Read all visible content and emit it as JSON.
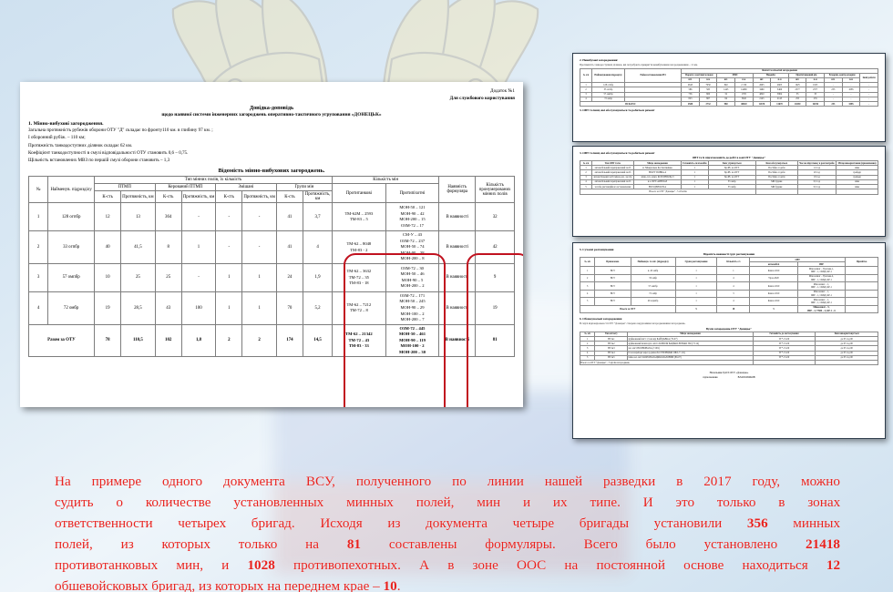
{
  "document": {
    "annex_label": "Додаток №1",
    "restriction": "Для службового користування",
    "title": "Довідка-доповідь",
    "subtitle": "щодо наявної системи інженерних загороджень оперативно-тактичного угруповання «ДОНЕЦЬК»",
    "section_heading": "1. Мінно-вибухові загородження.",
    "lines": [
      "Загальна протяжність рубежів оборони ОТУ \"Д\" складає по фронту110 км. в глибину 97 км. ;",
      "I оборонний рубіж. – 110 км;",
      "Протяжність танкодоступних ділянок складає 62 км.",
      "Коефіцієнт танкодоступності в смузі відповідальності ОТУ становить 0,6 – 0,75.",
      "Щільність встановлених МВЗ по першій смузі оборони становить – 1,3"
    ],
    "table_caption": "Відомість мінно-вибухових загороджень.",
    "table": {
      "group_headers": {
        "num": "№",
        "unit": "Найменув. підрозділу",
        "field_types": "Тип мінних полів, їх кількість",
        "mine_count": "Кількість мін",
        "formular": "Наявність формуляра",
        "numbered": "Кількість пронумерованих мінних полів"
      },
      "type_cols": [
        "ПТМП",
        "Керований ПТМП",
        "Змішані",
        "Групи мін"
      ],
      "sub_cols": [
        "К-сть",
        "Протяжність, км"
      ],
      "mine_cols": [
        "Протитанкові",
        "Протипіхотні"
      ],
      "rows": [
        {
          "num": "1",
          "unit": "128 огпбр",
          "ptmp_n": "12",
          "ptmp_km": "13",
          "ker_n": "364",
          "ker_km": "-",
          "mix_n": "-",
          "mix_km": "-",
          "grp_n": "41",
          "grp_km": "3,7",
          "at": "ТМ-62М – 2593\nТМ-83 – 5",
          "ap": "МОН-50 – 121\nМОН-90 – 42\nМОН-200 – 15\nОЗМ-72 – 17",
          "formular": "В наявності",
          "numbered": "32"
        },
        {
          "num": "2",
          "unit": "33 огпбр",
          "ptmp_n": "40",
          "ptmp_km": "41,5",
          "ker_n": "8",
          "ker_km": "1",
          "mix_n": "-",
          "mix_km": "-",
          "grp_n": "41",
          "grp_km": "4",
          "at": "ТМ-62 – 8048\nТМ-83 - 2",
          "ap": "СМ-У – 43\nОЗМ-72 – 237\nМОН-50 – 74\nМОН-90 – 38\nМОН-200 – 8",
          "formular": "В наявності",
          "numbered": "42"
        },
        {
          "num": "3",
          "unit": "57 омпбр",
          "ptmp_n": "10",
          "ptmp_km": "25",
          "ker_n": "25",
          "ker_km": "-",
          "mix_n": "1",
          "mix_km": "1",
          "grp_n": "24",
          "grp_km": "1,9",
          "at": "ТМ-62 – 3632\nТМ-72 – 35\nТМ-83 - 18",
          "ap": "ОЗМ-72 – 30\nМОН-50 – 46\nМОН-90 – 5\nМОН-200 – 2",
          "formular": "В наявності",
          "numbered": "9"
        },
        {
          "num": "4",
          "unit": "72 омбр",
          "ptmp_n": "19",
          "ptmp_km": "28,5",
          "ker_n": "43",
          "ker_km": "100",
          "mix_n": "1",
          "mix_km": "1",
          "grp_n": "70",
          "grp_km": "5,2",
          "at": "ТМ-62 – 7212\nТМ-72 – 8",
          "ap": "ОЗМ-72 – 171\nМОН-50 – 245\nМОН-90 – 29\nМОН-100 – 2\nМОН-200 – 7",
          "formular": "В наявності",
          "numbered": "19"
        }
      ],
      "total_row": {
        "label": "Разом за ОТУ",
        "ptmp_n": "78",
        "ptmp_km": "110,5",
        "ker_n": "102",
        "ker_km": "1,8",
        "mix_n": "2",
        "mix_km": "2",
        "grp_n": "174",
        "grp_km": "14,5",
        "at": "ТМ-62 – 21342\nТМ-72 – 43\nТМ-83 - 33",
        "ap": "ОЗМ-72 – 445\nМОН-50 – 461\nМОН-90 – 119\nМОН-100 - 2\nМОН-200 – 30",
        "formular": "В наявності",
        "numbered": "81"
      }
    }
  },
  "thumbnails": {
    "t1": {
      "heading": "2. Невибухові загородження:",
      "note": "Протяжність танкодоступних ділянок, які потребують прикриття невибуховими загородженнями – 11 км.",
      "cap": "Якісні та кількісні загородження",
      "cols": [
        "№ з/п",
        "Найменування підрозділу",
        "Район встановлення НЗ",
        "Пороги з кам'яної кладки",
        "МЗП",
        "Надовби",
        "Протитанковий рів",
        "Ескарпи, контр-ескарпи",
        "Інші роботи"
      ],
      "sub": [
        "шт.",
        "п.м"
      ],
      "rows": [
        {
          "n": "1",
          "u": "128 огпбр",
          "v": [
            "2643",
            "7950",
            "840",
            "2 150",
            "2605",
            "2605",
            "1025",
            "1025",
            "-",
            "-",
            "-"
          ]
        },
        {
          "n": "2",
          "u": "33 огпбр",
          "v": [
            "586",
            "585",
            "1445",
            "14480",
            "3460",
            "3460",
            "2577",
            "2577",
            "253",
            "1085",
            "-"
          ]
        },
        {
          "n": "3",
          "u": "57 омпбр",
          "v": [
            "756",
            "800",
            "32",
            "1705",
            "4820",
            "5804",
            "35",
            "35",
            "-",
            "-",
            "-"
          ]
        },
        {
          "n": "4",
          "u": "72 омбр",
          "v": [
            "823",
            "867",
            "84",
            "5645",
            "2145",
            "2145",
            "255",
            "255",
            "-",
            "-",
            "-"
          ]
        }
      ],
      "sum_label": "ВСЬОГО:",
      "sum": [
        "2588",
        "2732",
        "980",
        "48020",
        "12670",
        "12670",
        "10250",
        "10250",
        "253",
        "1085",
        "-"
      ]
    },
    "t2": {
      "heading": "3. ОВТ та інші, які обслуговуються та робиться ремонт",
      "cap": "ОВТ та їх підготовленість до робіт в зоні ОТУ \"Донецьк\"",
      "cols": [
        "№ з/п",
        "Тип ОВТ та ін.",
        "Місце знаходження",
        "Готовність сил/засобів",
        "Ким утримується",
        "Ким обслуговується",
        "Час на підготовку в разі потреби",
        "Місце використання (призначення)"
      ],
      "rows": [
        {
          "v": [
            "1",
            "автомобільний переправочний засіб",
            "м. Мінеральне Костянтинівка",
            "1",
            "Бр.ІН- на ОТУ",
            "Постійно 4 доби",
            "1,5 год",
            "зима"
          ]
        },
        {
          "v": [
            "2",
            "автомобільний переправочний засіб",
            "ВП.РУ ПОВБА-4",
            "1",
            "Бр.ІН- на ОТУ",
            "Постійно 4 доби",
            "20 год",
            "грейдер"
          ]
        },
        {
          "v": [
            "3",
            "автомобільний засіб мінно-раз. засобу",
            "мінн.-тех. комп. КСПЛ/ЮК/Бр.З",
            "1",
            "Бр.ІН- на ОТУ",
            "Постійно 4 доби",
            "18 год",
            "грейдер"
          ]
        },
        {
          "v": [
            "4",
            "автомобільний переправочний засіб",
            "в.ч. ПРУ-АЙН БАЗ",
            "1",
            "33 омбр",
            "МБ будник",
            "0,5 год",
            "зима"
          ]
        },
        {
          "v": [
            "5",
            "засоби дистанційного встановлення",
            "ВП.З/ДВ/Б.Б.Н.А",
            "1",
            "33 омбр",
            "МБ будник",
            "0,5 год",
            "зима"
          ]
        }
      ],
      "sum_label": "Всього за ОТУ \"Донецьк\" - 5 об'єктів"
    },
    "t3": {
      "heading_a": "5. Сучасні розташування",
      "cap_a": "Відомість наявності груп розташування",
      "cols_a": [
        "№ з/п",
        "Приналежн.",
        "Найменув. та міс. (підрозділ)",
        "Групи розташування",
        "Кількість с/з",
        "ОВТ",
        "Примітка"
      ],
      "sub_a": [
        "автомобілі",
        "ІМР"
      ],
      "rows_a": [
        {
          "v": [
            "1",
            "ВСУ",
            "в. 45 омбр",
            "1",
            "1",
            "Камаз 4310",
            "Мінозахват – Урагани-1,\nІМР – 1, СКБД, КР-1",
            ""
          ]
        },
        {
          "v": [
            "2",
            "ВСУ",
            "33 омбр",
            "1",
            "4",
            "Урал-4320",
            "Мінозахват – Урагани-2,\nІМР – 1, СКБД, КР-1",
            ""
          ]
        },
        {
          "v": [
            "3",
            "ВСУ",
            "57 омпбр",
            "1",
            "4",
            "Камаз 4310",
            "Мінозахват – 1,\nІМР – 1, СКБД, КР-1",
            ""
          ]
        },
        {
          "v": [
            "4",
            "ВСУ",
            "72 омбр",
            "1",
            "3",
            "Камаз 4310",
            "Мінозахват – 1,\nІМР – 1, СКБД, КР-1",
            ""
          ]
        },
        {
          "v": [
            "5",
            "ВСУ",
            "46 огдшбр",
            "1",
            "4",
            "Камаз 4310",
            "Мінозахват – 1,\nІМР – 1, СКБД, КР-1",
            ""
          ]
        }
      ],
      "sum_a_label": "Всього за ОТУ",
      "sum_a": [
        "5",
        "18",
        "5",
        "Мінозахват – 5,\nІМР – 4, УМБ – 4, КР-1 – 6",
        ""
      ],
      "heading_b": "6. Обмежувальні загородження",
      "note_b": "В смузі відповідальності ОТУ \"Донецьк\" створено нерухомими загородженнями загороджень.",
      "cap_b": "Вузли загороджень ОТУ \"Донецьк\"",
      "cols_b": [
        "№ з/п",
        "Тип об'єкту",
        "Місце знаходження",
        "Готовність до застосування",
        "Ким використовується"
      ],
      "rows_b": [
        {
          "v": [
            "1",
            "ВЗ №1",
            "зруйнований міст 1,5 км від БАЙДАВКА (70-07)",
            "ТГ*-15-00",
            "до 05 год 00"
          ]
        },
        {
          "v": [
            "2",
            "ВЗ №2",
            "зруйнований шлях вузл. місто КОРОЛЬ БАЦЬКО-ВІТЬКО 560 (73-14)",
            "ТГ*-15-00",
            "до 05 год 00"
          ]
        },
        {
          "v": [
            "3",
            "ВЗ №3",
            "зал. міст ВОЛНОВАХА (7-001)",
            "ТГ*-15-00",
            "до 05 год 00"
          ]
        },
        {
          "v": [
            "4",
            "ВЗ №4",
            "6 зал.переїзди через р.район Б.СТРІЛЕЦЬКІ ОБЛ./7-111)",
            "ТГ*-15-00",
            "до 05 год 00"
          ]
        },
        {
          "v": [
            "5",
            "ВЗ №5",
            "байн-зал. міст КОРОЛЬ-БАЦЬКО-БАЗОВИЙ (86-07)",
            "ТГ*-15-00",
            "до 05 год 00"
          ]
        }
      ],
      "sum_b_label": "Всього за ОТУ \"Донецьк\" - 5 вузлів загороджень",
      "sign_title": "Начальник ГрОЗ ОТУ «Донецьк»",
      "sign_left": "підполковник",
      "sign_right": "В.М.ПОЛЯКОВ"
    }
  },
  "caption": {
    "lines": [
      "На примере одного документа ВСУ, полученного по линии нашей разведки в 2017 году, можно",
      "судить о количестве установленных минных полей, мин и их типе. И это только в зонах",
      "ответственности четырех бригад. Исходя из документа четыре бригады установили 356 минных",
      "полей, из которых только на 81 составлены формуляры. Всего было установлено 21418",
      "противотанковых мин, и 1028 противопехотных. А в зоне ООС на постоянной основе находиться 12",
      "обшевойсковых бригад, из которых на переднем крае – 10."
    ],
    "highlights": [
      "356",
      "81",
      "21418",
      "1028",
      "12",
      "10"
    ],
    "color": "#e8231f"
  }
}
